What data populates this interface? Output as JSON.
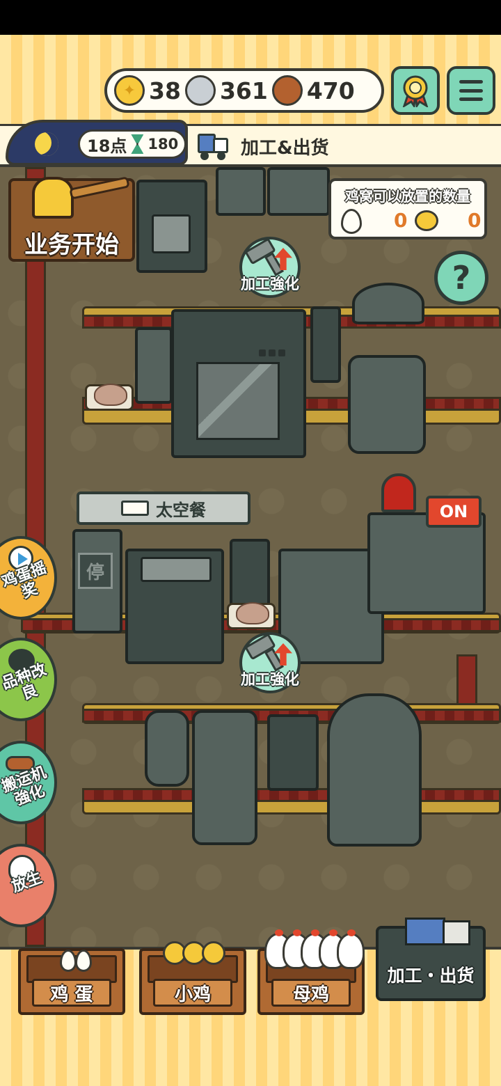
{
  "currency": {
    "gold": "38",
    "silver": "361",
    "copper": "470"
  },
  "time": {
    "hour": "18点",
    "timer": "180"
  },
  "header": {
    "title": "加工&出货"
  },
  "start_button": {
    "label": "业务开始"
  },
  "nest_capacity": {
    "title": "鸡窝可以放置的数量",
    "eggs": "0",
    "chicks": "0"
  },
  "upgrade_buttons": [
    {
      "label": "加工強化"
    },
    {
      "label": "加工強化"
    }
  ],
  "machines": {
    "product_name": "太空餐",
    "switch_label": "ON",
    "stop_label": "停"
  },
  "side_buttons": [
    {
      "label": "鸡蛋摇奖"
    },
    {
      "label": "品种改良"
    },
    {
      "label": "搬运机強化"
    },
    {
      "label": "放生"
    }
  ],
  "bottom_nav": {
    "eggs": "鸡 蛋",
    "chicks": "小鸡",
    "hens": "母鸡",
    "ship": "加工・出货"
  },
  "colors": {
    "accent_green": "#7fd6b7",
    "wood": "#b06a33",
    "factory_floor": "#6e6349",
    "value_orange": "#e07a2a"
  }
}
